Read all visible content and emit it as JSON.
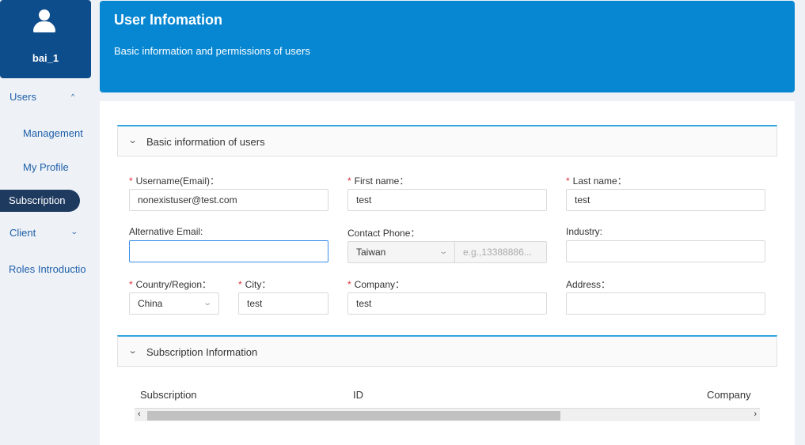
{
  "user": {
    "name": "bai_1"
  },
  "nav": {
    "users": "Users",
    "management": "Management",
    "my_profile": "My Profile",
    "subscription": "Subscription",
    "client": "Client",
    "roles": "Roles Introductio"
  },
  "header": {
    "title": "User Infomation",
    "subtitle": "Basic information and permissions of users"
  },
  "basic_section": {
    "title": "Basic information of users",
    "fields": {
      "username": {
        "label": "Username(Email)：",
        "value": "nonexistuser@test.com",
        "required": true
      },
      "first_name": {
        "label": "First name：",
        "value": "test",
        "required": true
      },
      "last_name": {
        "label": "Last name：",
        "value": "test",
        "required": true
      },
      "alt_email": {
        "label": "Alternative Email:",
        "value": ""
      },
      "contact_phone": {
        "label": "Contact Phone：",
        "country": "Taiwan",
        "placeholder": "e.g.,13388886..."
      },
      "industry": {
        "label": "Industry:",
        "value": ""
      },
      "country": {
        "label": "Country/Region：",
        "value": "China",
        "required": true
      },
      "city": {
        "label": "City：",
        "value": "test",
        "required": true
      },
      "company": {
        "label": "Company：",
        "value": "test",
        "required": true
      },
      "address": {
        "label": "Address：",
        "value": ""
      }
    }
  },
  "subscription_section": {
    "title": "Subscription Information",
    "columns": [
      "Subscription",
      "ID",
      "Company"
    ]
  },
  "colors": {
    "header_bg": "#0787d2",
    "user_card_bg": "#0e4d8c",
    "active_nav_bg": "#1e3a5f",
    "required_mark": "#e0303a",
    "section_accent": "#2fa6e0"
  }
}
